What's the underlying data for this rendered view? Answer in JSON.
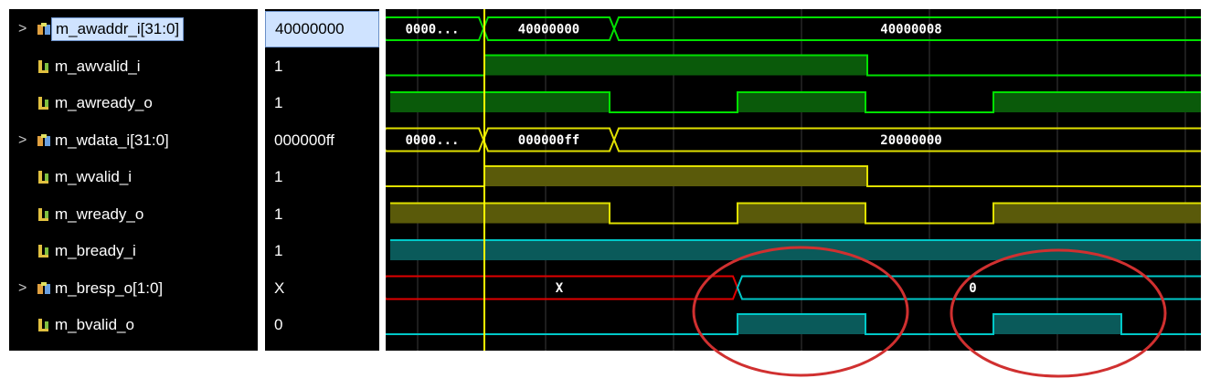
{
  "signals": [
    {
      "name": "m_awaddr_i[31:0]",
      "value": "40000000",
      "bus": true,
      "expandable": true,
      "selected": true,
      "icon": "bus-signal-icon"
    },
    {
      "name": "m_awvalid_i",
      "value": "1",
      "bus": false,
      "expandable": false,
      "icon": "wire-signal-icon"
    },
    {
      "name": "m_awready_o",
      "value": "1",
      "bus": false,
      "expandable": false,
      "icon": "wire-signal-icon"
    },
    {
      "name": "m_wdata_i[31:0]",
      "value": "000000ff",
      "bus": true,
      "expandable": true,
      "icon": "bus-signal-icon"
    },
    {
      "name": "m_wvalid_i",
      "value": "1",
      "bus": false,
      "expandable": false,
      "icon": "wire-signal-icon"
    },
    {
      "name": "m_wready_o",
      "value": "1",
      "bus": false,
      "expandable": false,
      "icon": "wire-signal-icon"
    },
    {
      "name": "m_bready_i",
      "value": "1",
      "bus": false,
      "expandable": false,
      "icon": "wire-signal-icon"
    },
    {
      "name": "m_bresp_o[1:0]",
      "value": "X",
      "bus": true,
      "expandable": true,
      "icon": "bus-signal-icon"
    },
    {
      "name": "m_bvalid_o",
      "value": "0",
      "bus": false,
      "expandable": false,
      "icon": "wire-signal-icon"
    }
  ],
  "expander_glyph": ">",
  "waveform": {
    "colors": {
      "green": "#00e000",
      "green_fill": "#0a5a0a",
      "yellow": "#e0e000",
      "yellow_fill": "#5a5a0a",
      "cyan": "#00c8c8",
      "cyan_fill": "#0a5a5a",
      "red": "#e00000",
      "cursor": "#ffff00",
      "grid": "#3a3a3a",
      "annotation": "#d03030"
    },
    "bus_labels": {
      "awaddr": [
        "0000...",
        "40000000",
        "40000008"
      ],
      "wdata": [
        "0000...",
        "000000ff",
        "20000000"
      ],
      "bresp": [
        "X",
        "0"
      ]
    }
  }
}
